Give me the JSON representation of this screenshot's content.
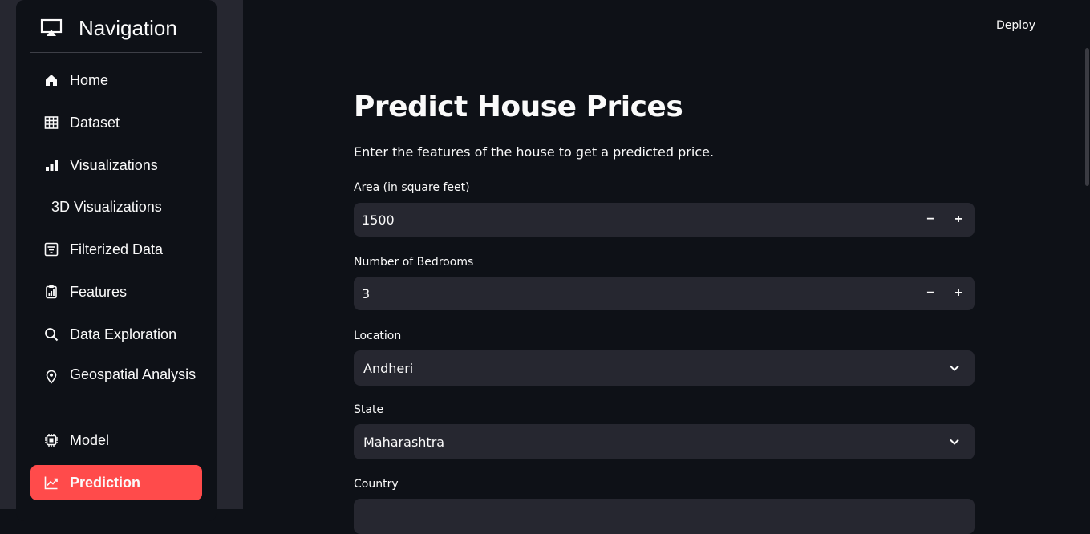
{
  "sidebar": {
    "title": "Navigation",
    "items": [
      {
        "label": "Home",
        "icon": "home-icon"
      },
      {
        "label": "Dataset",
        "icon": "table-icon"
      },
      {
        "label": "Visualizations",
        "icon": "bar-chart-icon"
      },
      {
        "label": "3D Visualizations",
        "icon": ""
      },
      {
        "label": "Filterized Data",
        "icon": "filter-list-icon"
      },
      {
        "label": "Features",
        "icon": "clipboard-chart-icon"
      },
      {
        "label": "Data Exploration",
        "icon": "search-icon"
      },
      {
        "label": "Geospatial Analysis",
        "icon": "map-pin-icon"
      },
      {
        "label": "Model",
        "icon": "chip-icon"
      },
      {
        "label": "Prediction",
        "icon": "trend-chart-icon"
      }
    ],
    "active_item": "Prediction",
    "accent_color": "#ff4b4b"
  },
  "header": {
    "deploy_label": "Deploy"
  },
  "main": {
    "title": "Predict House Prices",
    "subtitle": "Enter the features of the house to get a predicted price.",
    "fields": {
      "area": {
        "label": "Area (in square feet)",
        "value": "1500",
        "minus": "−",
        "plus": "+"
      },
      "bedrooms": {
        "label": "Number of Bedrooms",
        "value": "3",
        "minus": "−",
        "plus": "+"
      },
      "location": {
        "label": "Location",
        "value": "Andheri"
      },
      "state": {
        "label": "State",
        "value": "Maharashtra"
      },
      "country": {
        "label": "Country"
      }
    }
  }
}
